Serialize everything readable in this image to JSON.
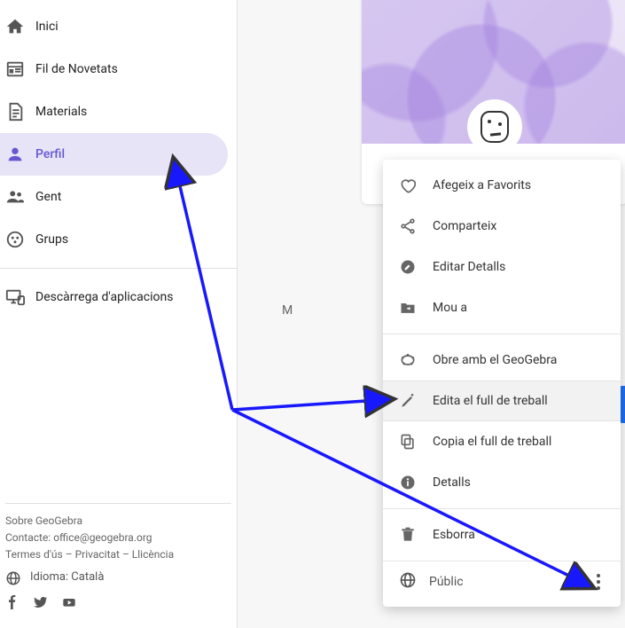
{
  "sidebar": {
    "items": [
      {
        "label": "Inici"
      },
      {
        "label": "Fil de Novetats"
      },
      {
        "label": "Materials"
      },
      {
        "label": "Perfil"
      },
      {
        "label": "Gent"
      },
      {
        "label": "Grups"
      }
    ],
    "downloads_label": "Descàrrega d'aplicacions"
  },
  "footer": {
    "about": "Sobre GeoGebra",
    "contact_prefix": "Contacte: ",
    "contact_email": "office@geogebra.org",
    "terms": "Termes d'ús",
    "privacy": "Privacitat",
    "license": "Llicència",
    "language_prefix": "Idioma: ",
    "language": "Català",
    "sep": "  –  "
  },
  "main": {
    "label_prefix": "M"
  },
  "menu": {
    "favorite": "Afegeix a Favorits",
    "share": "Comparteix",
    "edit_details": "Editar Detalls",
    "move_to": "Mou a",
    "open_geogebra": "Obre amb el GeoGebra",
    "edit_sheet": "Edita el full de treball",
    "copy_sheet": "Copia el full de treball",
    "details": "Detalls",
    "delete": "Esborra",
    "visibility": "Públic"
  }
}
